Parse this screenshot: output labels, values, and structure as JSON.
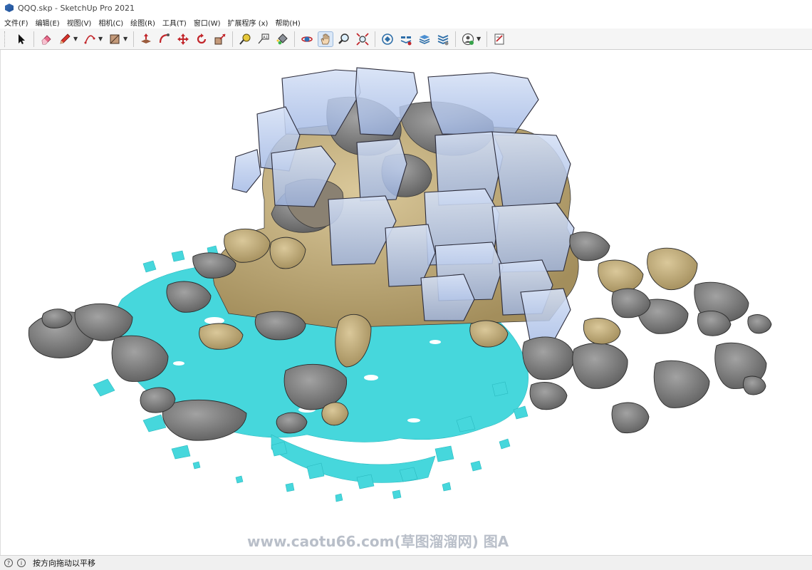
{
  "window": {
    "title": "QQQ.skp - SketchUp Pro 2021"
  },
  "menu": [
    "文件(F)",
    "编辑(E)",
    "视图(V)",
    "相机(C)",
    "绘图(R)",
    "工具(T)",
    "窗口(W)",
    "扩展程序 (x)",
    "帮助(H)"
  ],
  "toolbar": {
    "tools": [
      "select-icon",
      "eraser-icon",
      "pencil-icon",
      "arc-icon",
      "rectangle-icon",
      "push-pull-icon",
      "follow-me-icon",
      "move-icon",
      "rotate-icon",
      "scale-icon",
      "tape-measure-icon",
      "text-icon",
      "paint-bucket-icon",
      "orbit-icon",
      "pan-icon",
      "zoom-icon",
      "zoom-extents-icon",
      "warehouse-icon",
      "extension-warehouse-icon",
      "layout-icon",
      "extension-manager-icon",
      "profile-icon",
      "license-icon"
    ],
    "active_tool": "pan-icon"
  },
  "viewport": {
    "watermark": "www.caotu66.com(草图溜溜网) 图A"
  },
  "statusbar": {
    "message": "按方向拖动以平移"
  },
  "colors": {
    "water": "#46d7dc",
    "rock_gray": "#7d7d7d",
    "rock_tan": "#c9b483",
    "glass": "#b7c9ec"
  }
}
